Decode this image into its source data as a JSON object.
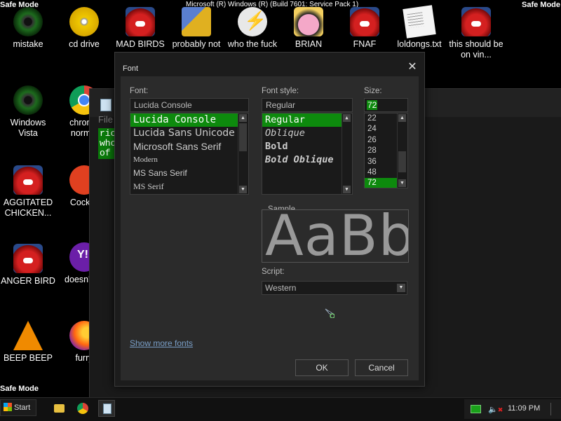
{
  "mode_label": "Safe Mode",
  "os_title": "Microsoft (R) Windows (R) (Build 7601: Service Pack 1)",
  "desktop_icons": [
    {
      "label": "mistake",
      "icon": "disc-icon"
    },
    {
      "label": "cd drive",
      "icon": "cd-icon"
    },
    {
      "label": "MAD BIRDS",
      "icon": "angry-bird-icon"
    },
    {
      "label": "probably not",
      "icon": "gears-icon"
    },
    {
      "label": "who the fuck",
      "icon": "lightning-icon"
    },
    {
      "label": "BRIAN",
      "icon": "pig-icon"
    },
    {
      "label": "FNAF",
      "icon": "angry-bird-icon"
    },
    {
      "label": "loldongs.txt",
      "icon": "text-file-icon"
    },
    {
      "label": "this should be on vin...",
      "icon": "angry-bird-icon"
    },
    {
      "label": "Windows Vista",
      "icon": "recycle-icon"
    },
    {
      "label": "chrome normal",
      "icon": "chrome-icon"
    },
    {
      "label": "AGGITATED CHICKEN...",
      "icon": "angry-bird-icon"
    },
    {
      "label": "CockCl",
      "icon": "app-icon"
    },
    {
      "label": "ANGER BIRD",
      "icon": "angry-bird-icon"
    },
    {
      "label": "doesn't lol",
      "icon": "yahoo-icon"
    },
    {
      "label": "BEEP BEEP",
      "icon": "vlc-icon"
    },
    {
      "label": "furry",
      "icon": "firefox-icon"
    }
  ],
  "notepad": {
    "menu_partial": "File",
    "text_lines": [
      "ric",
      "who",
      "of"
    ]
  },
  "font_dialog": {
    "title": "Font",
    "font_label": "Font:",
    "font_value": "Lucida Console",
    "font_list": [
      "Lucida Console",
      "Lucida Sans Unicode",
      "Microsoft Sans Serif",
      "Modern",
      "MS Sans Serif",
      "MS Serif"
    ],
    "font_selected": "Lucida Console",
    "style_label": "Font style:",
    "style_value": "Regular",
    "style_list": [
      "Regular",
      "Oblique",
      "Bold",
      "Bold Oblique"
    ],
    "style_selected": "Regular",
    "size_label": "Size:",
    "size_value": "72",
    "size_list": [
      "22",
      "24",
      "26",
      "28",
      "36",
      "48",
      "72"
    ],
    "size_selected": "72",
    "sample_label": "Sample",
    "sample_text": "AaBb",
    "script_label": "Script:",
    "script_value": "Western",
    "show_more_fonts": "Show more fonts",
    "ok_label": "OK",
    "cancel_label": "Cancel"
  },
  "taskbar": {
    "start_label": "Start",
    "time": "11:09 PM"
  },
  "colors": {
    "selection": "#0d8a0d",
    "link": "#7a9fc8"
  }
}
